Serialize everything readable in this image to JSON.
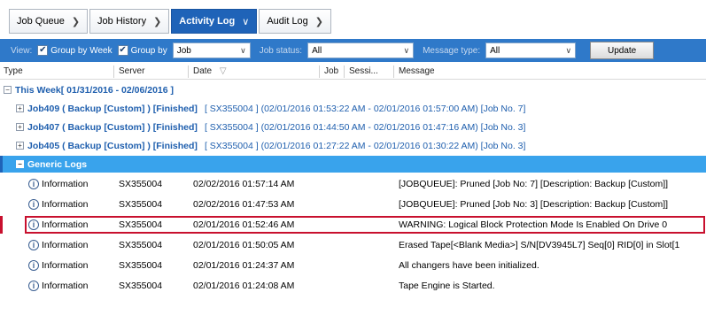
{
  "tabs": [
    {
      "label": "Job Queue",
      "active": false
    },
    {
      "label": "Job History",
      "active": false
    },
    {
      "label": "Activity Log",
      "active": true
    },
    {
      "label": "Audit Log",
      "active": false
    }
  ],
  "filter": {
    "view_label": "View:",
    "group_by_week_label": "Group by Week",
    "group_by_week_checked": true,
    "group_by_label": "Group by",
    "group_by_checked": true,
    "group_by_value": "Job",
    "job_status_label": "Job status:",
    "job_status_value": "All",
    "message_type_label": "Message type:",
    "message_type_value": "All",
    "update_label": "Update"
  },
  "columns": {
    "type": "Type",
    "server": "Server",
    "date": "Date",
    "job": "Job",
    "session": "Sessi...",
    "message": "Message"
  },
  "week_group": {
    "label": "This Week[ 01/31/2016 - 02/06/2016 ]"
  },
  "jobs": [
    {
      "name": "Job409 ( Backup [Custom] ) [Finished]",
      "detail": "[ SX355004 ] (02/01/2016 01:53:22 AM - 02/01/2016 01:57:00 AM) [Job No. 7]"
    },
    {
      "name": "Job407 ( Backup [Custom] ) [Finished]",
      "detail": "[ SX355004 ] (02/01/2016 01:44:50 AM - 02/01/2016 01:47:16 AM) [Job No. 3]"
    },
    {
      "name": "Job405 ( Backup [Custom] ) [Finished]",
      "detail": "[ SX355004 ] (02/01/2016 01:27:22 AM - 02/01/2016 01:30:22 AM) [Job No. 3]"
    }
  ],
  "generic_logs": {
    "label": "Generic Logs",
    "rows": [
      {
        "type": "Information",
        "server": "SX355004",
        "date": "02/02/2016 01:57:14 AM",
        "message": "[JOBQUEUE]: Pruned [Job No: 7] [Description: Backup [Custom]]"
      },
      {
        "type": "Information",
        "server": "SX355004",
        "date": "02/02/2016 01:47:53 AM",
        "message": "[JOBQUEUE]: Pruned [Job No: 3] [Description: Backup [Custom]]"
      },
      {
        "type": "Information",
        "server": "SX355004",
        "date": "02/01/2016 01:52:46 AM",
        "message": "WARNING: Logical Block Protection Mode Is Enabled On Drive 0"
      },
      {
        "type": "Information",
        "server": "SX355004",
        "date": "02/01/2016 01:50:05 AM",
        "message": "Erased Tape[<Blank Media>] S/N[DV3945L7] Seq[0] RID[0] in Slot[1"
      },
      {
        "type": "Information",
        "server": "SX355004",
        "date": "02/01/2016 01:24:37 AM",
        "message": "All changers have been initialized."
      },
      {
        "type": "Information",
        "server": "SX355004",
        "date": "02/01/2016 01:24:08 AM",
        "message": "Tape Engine is Started."
      }
    ]
  },
  "icons": {
    "expand_collapsed": "plus-box-icon",
    "expand_open": "minus-box-icon",
    "info": "information-icon",
    "tab_arrow": "chevron-right-icon",
    "dropdown": "chevron-down-icon",
    "sort": "sort-down-icon"
  },
  "colors": {
    "filter_bar": "#2f79c9",
    "active_tab": "#1f63b8",
    "generic_logs_row": "#39a3ec",
    "group_text": "#1f5fae",
    "highlight": "#c8102e"
  }
}
